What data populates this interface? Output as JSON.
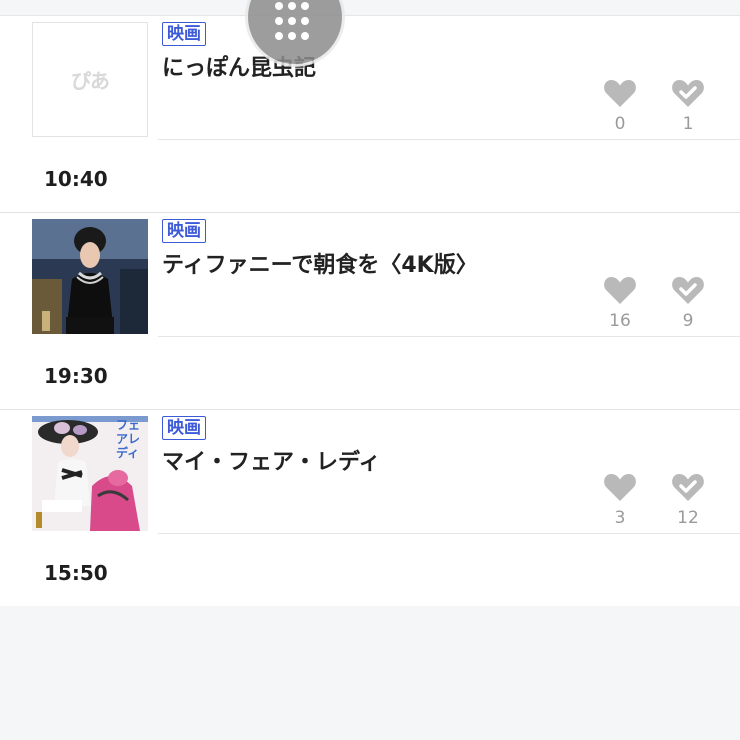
{
  "items": [
    {
      "category": "映画",
      "title": "にっぽん昆虫記",
      "time": "10:40",
      "thumbnail": "placeholder",
      "placeholder_logo": "ぴあ",
      "like_count": "0",
      "check_count": "1"
    },
    {
      "category": "映画",
      "title": "ティファニーで朝食を〈4K版〉",
      "time": "19:30",
      "thumbnail": "poster",
      "like_count": "16",
      "check_count": "9"
    },
    {
      "category": "映画",
      "title": "マイ・フェア・レディ",
      "time": "15:50",
      "thumbnail": "poster",
      "poster_text": "フェアレディ",
      "like_count": "3",
      "check_count": "12"
    }
  ],
  "icons": {
    "fab": "grid-dots-icon",
    "like": "heart-icon",
    "check": "heart-check-icon"
  },
  "colors": {
    "badge": "#3d5bd9",
    "icon_gray": "#b9b9b9",
    "count_gray": "#9a9a9a"
  }
}
